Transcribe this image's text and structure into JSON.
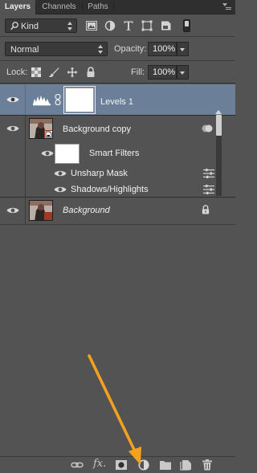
{
  "tabs": [
    {
      "label": "Layers",
      "active": true
    },
    {
      "label": "Channels",
      "active": false
    },
    {
      "label": "Paths",
      "active": false
    }
  ],
  "filter": {
    "kind_value": "Kind",
    "icons": [
      "pixel-layer-filter-icon",
      "adjustment-layer-filter-icon",
      "type-layer-filter-icon",
      "shape-layer-filter-icon",
      "smart-object-filter-icon"
    ]
  },
  "blend": {
    "mode_value": "Normal",
    "opacity_label": "Opacity:",
    "opacity_value": "100%"
  },
  "lock": {
    "label": "Lock:",
    "fill_label": "Fill:",
    "fill_value": "100%"
  },
  "layers": [
    {
      "name": "Levels 1",
      "type": "adjustment",
      "selected": true,
      "visible": true
    },
    {
      "name": "Background copy",
      "type": "smart-object",
      "selected": false,
      "visible": true,
      "smart_filters_label": "Smart Filters",
      "filters": [
        {
          "name": "Unsharp Mask"
        },
        {
          "name": "Shadows/Highlights"
        }
      ]
    },
    {
      "name": "Background",
      "type": "background",
      "selected": false,
      "visible": true,
      "locked": true
    }
  ],
  "bottom_toolbar": {
    "fx_label": "fx.",
    "icons": [
      "link-layers-icon",
      "layer-style-icon",
      "layer-mask-icon",
      "adjustment-layer-icon",
      "new-group-icon",
      "new-layer-icon",
      "delete-layer-icon"
    ]
  },
  "colors": {
    "panel_bg": "#535353",
    "selected_row": "#6b7f99",
    "annotation_arrow": "#f4a21d"
  }
}
